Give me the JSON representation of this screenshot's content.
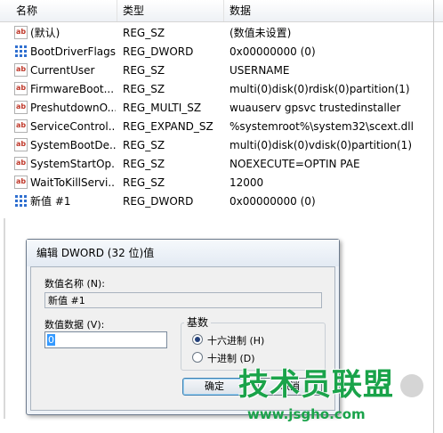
{
  "columns": {
    "name": "名称",
    "type": "类型",
    "data": "数据"
  },
  "rows": [
    {
      "icon": "string-value-icon",
      "name": "(默认)",
      "type": "REG_SZ",
      "data": "(数值未设置)"
    },
    {
      "icon": "binary-value-icon",
      "name": "BootDriverFlags",
      "type": "REG_DWORD",
      "data": "0x00000000 (0)"
    },
    {
      "icon": "string-value-icon",
      "name": "CurrentUser",
      "type": "REG_SZ",
      "data": "USERNAME"
    },
    {
      "icon": "string-value-icon",
      "name": "FirmwareBoot...",
      "type": "REG_SZ",
      "data": "multi(0)disk(0)rdisk(0)partition(1)"
    },
    {
      "icon": "string-value-icon",
      "name": "PreshutdownO...",
      "type": "REG_MULTI_SZ",
      "data": "wuauserv gpsvc trustedinstaller"
    },
    {
      "icon": "string-value-icon",
      "name": "ServiceControl...",
      "type": "REG_EXPAND_SZ",
      "data": "%systemroot%\\system32\\scext.dll"
    },
    {
      "icon": "string-value-icon",
      "name": "SystemBootDe...",
      "type": "REG_SZ",
      "data": "multi(0)disk(0)vdisk(0)partition(1)"
    },
    {
      "icon": "string-value-icon",
      "name": "SystemStartOp...",
      "type": "REG_SZ",
      "data": " NOEXECUTE=OPTIN  PAE"
    },
    {
      "icon": "string-value-icon",
      "name": "WaitToKillServi...",
      "type": "REG_SZ",
      "data": "12000"
    },
    {
      "icon": "binary-value-icon",
      "name": "新值 #1",
      "type": "REG_DWORD",
      "data": "0x00000000 (0)"
    }
  ],
  "dialog": {
    "title": "编辑 DWORD (32 位)值",
    "value_name_label": "数值名称 (N):",
    "value_name": "新值 #1",
    "value_data_label": "数值数据 (V):",
    "value_data": "0",
    "base_label": "基数",
    "base_options": [
      {
        "label": "十六进制 (H)",
        "selected": true
      },
      {
        "label": "十进制 (D)",
        "selected": false
      }
    ],
    "ok_label": "确定",
    "cancel_label": "取消"
  },
  "watermark": {
    "brand": "技术员联盟",
    "url": "www.jsgho.com"
  },
  "colors": {
    "selection": "#3399ff",
    "watermark": "#1aa34a",
    "dialog_bg": "#f0f0f0"
  }
}
